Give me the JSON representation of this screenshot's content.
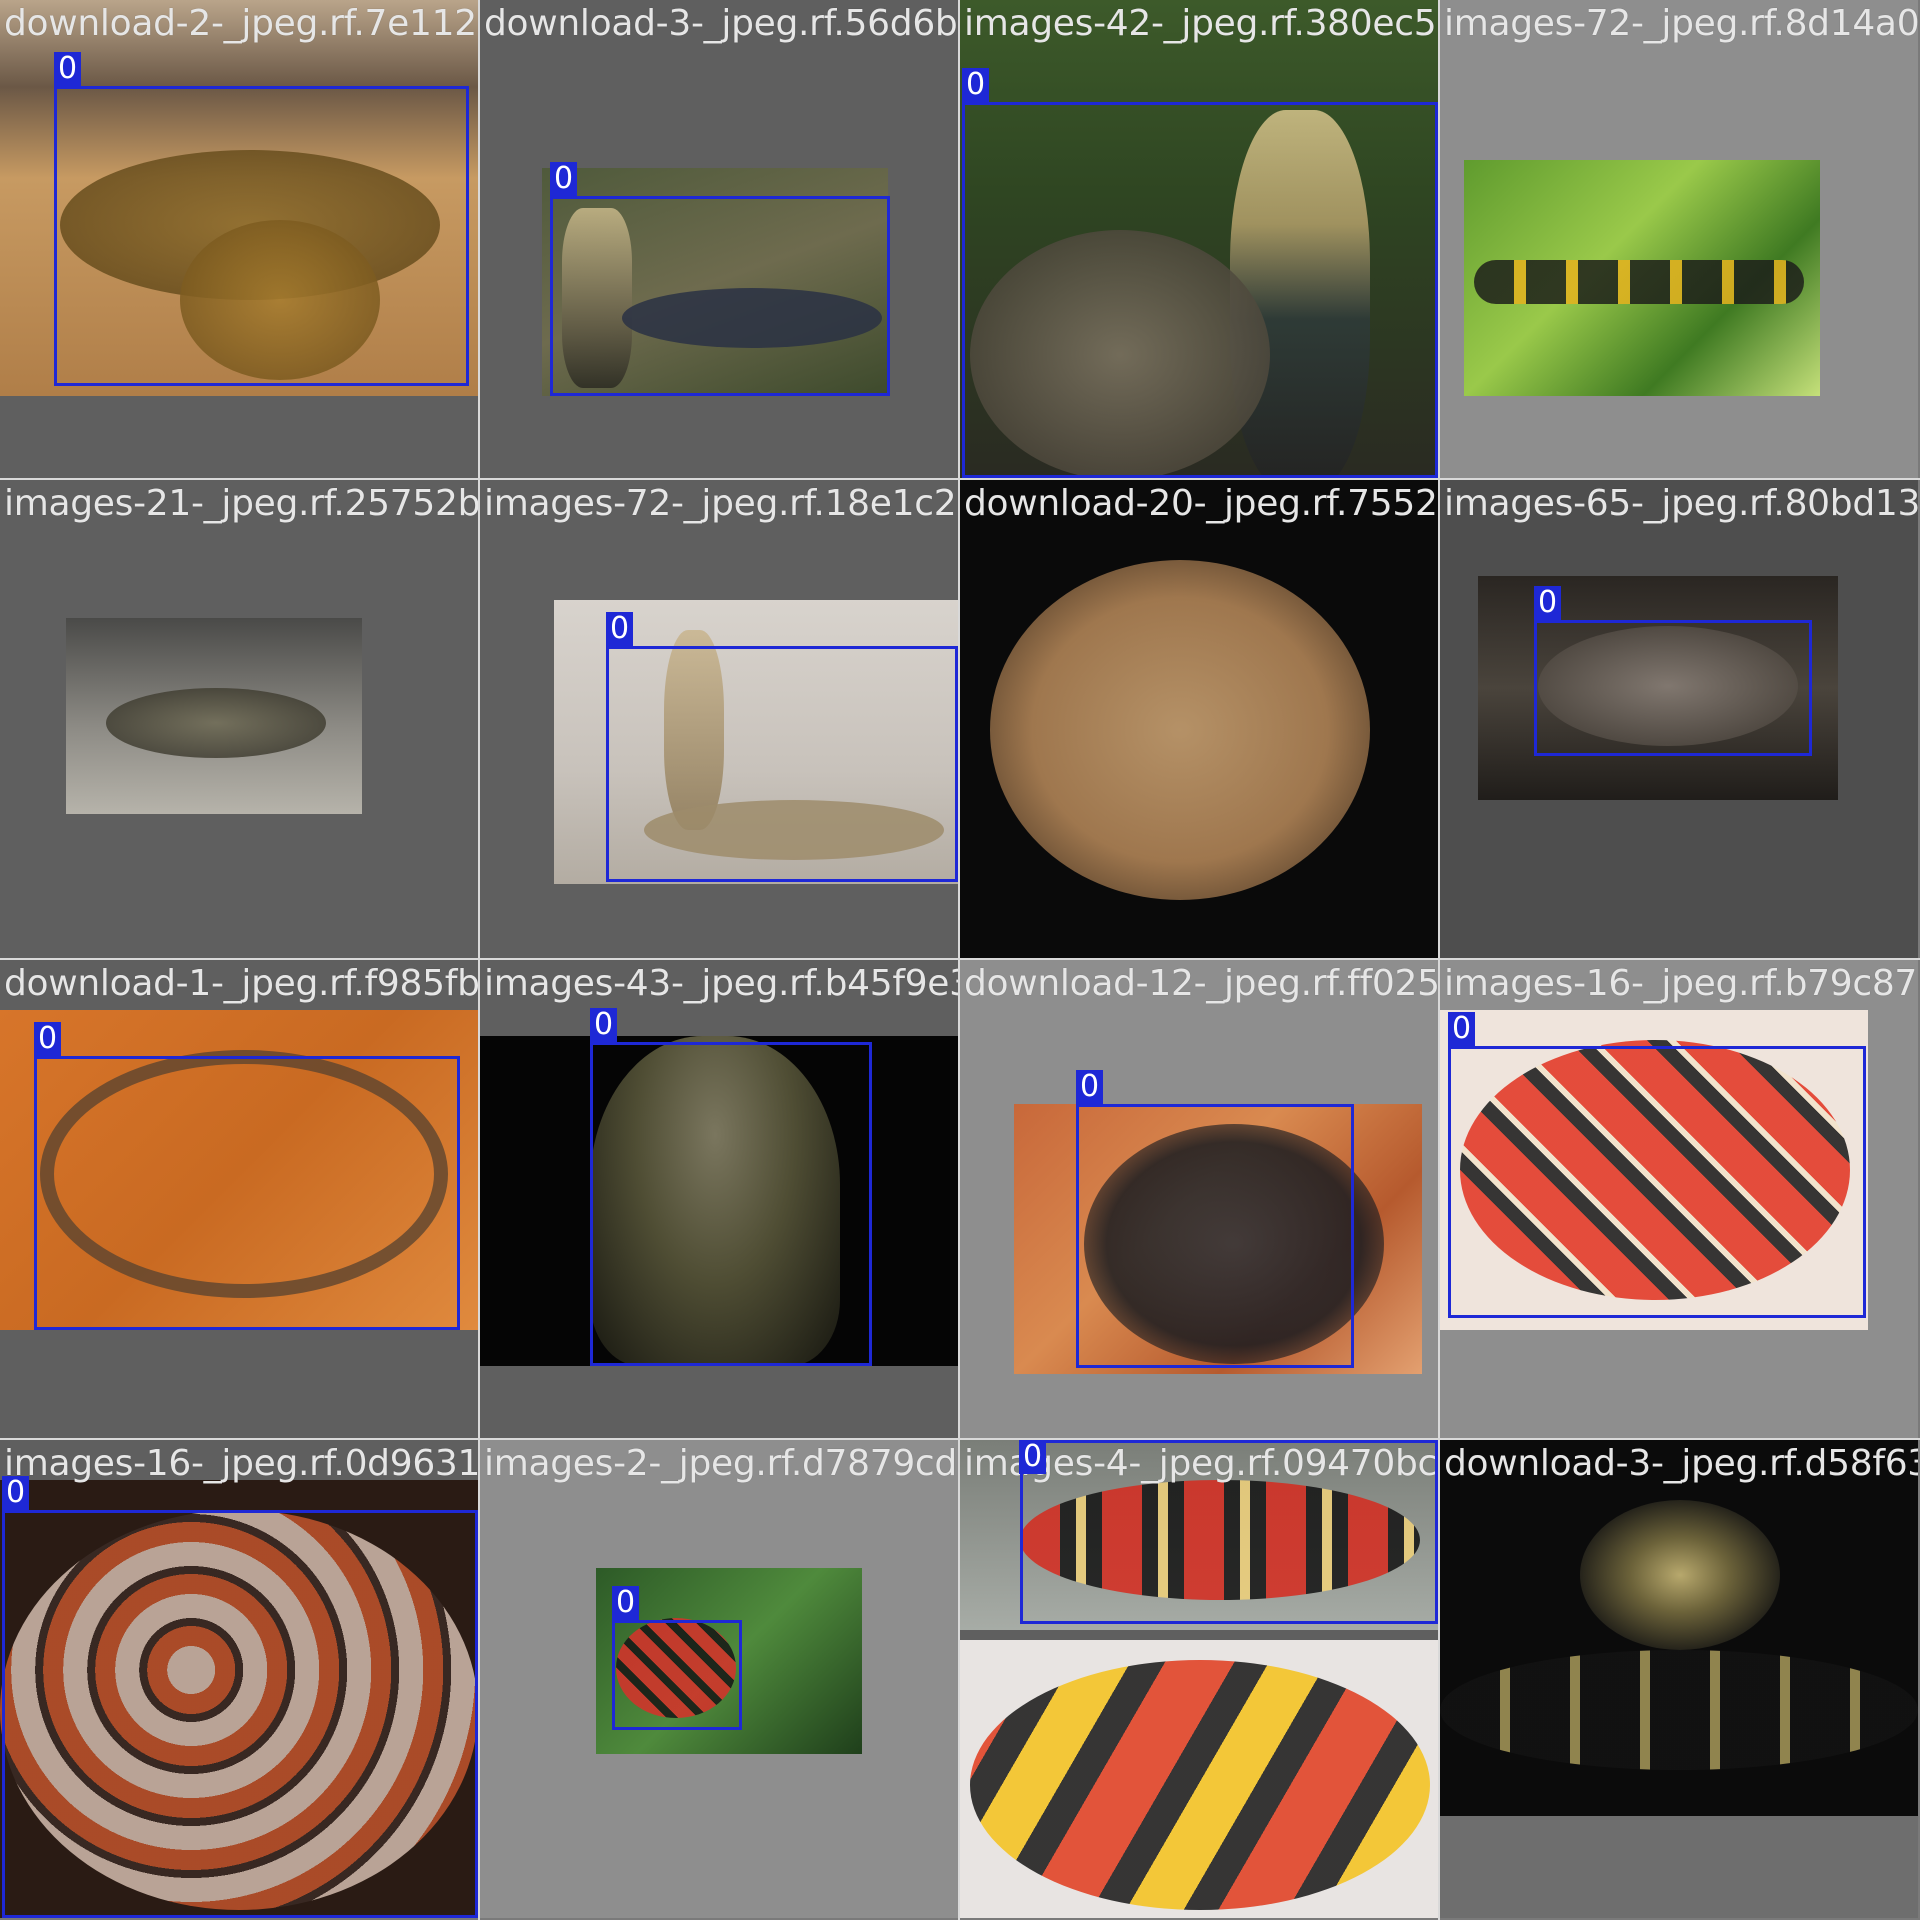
{
  "mosaic": {
    "tiles": [
      {
        "filename": "download-2-_jpeg.rf.7e112e4b6f7974fa7a92",
        "boxes": [
          {
            "label": "0"
          }
        ]
      },
      {
        "filename": "download-3-_jpeg.rf.56d6b8c3e347766b55",
        "boxes": [
          {
            "label": "0"
          }
        ]
      },
      {
        "filename": "images-42-_jpeg.rf.380ec58bd50ae1723e9e0",
        "boxes": [
          {
            "label": "0"
          }
        ]
      },
      {
        "filename": "images-72-_jpeg.rf.8d14a0c",
        "boxes": []
      },
      {
        "filename": "images-21-_jpeg.rf.25752b17f1e4b372a00ffb",
        "boxes": []
      },
      {
        "filename": "images-72-_jpeg.rf.18e1c21ebe5aa2ab86063",
        "boxes": [
          {
            "label": "0"
          }
        ]
      },
      {
        "filename": "download-20-_jpeg.rf.75527d8396906755aff9",
        "boxes": []
      },
      {
        "filename": "images-65-_jpeg.rf.80bd136",
        "boxes": [
          {
            "label": "0"
          }
        ]
      },
      {
        "filename": "download-1-_jpeg.rf.f985fb82edb1f5418ab63",
        "boxes": [
          {
            "label": "0"
          }
        ]
      },
      {
        "filename": "images-43-_jpeg.rf.b45f9e35d050319262b4",
        "boxes": [
          {
            "label": "0"
          }
        ]
      },
      {
        "filename": "download-12-_jpeg.rf.ff025d1446334d6764f",
        "boxes": [
          {
            "label": "0"
          }
        ]
      },
      {
        "filename": "images-16-_jpeg.rf.b79c87c",
        "boxes": [
          {
            "label": "0"
          }
        ]
      },
      {
        "filename": "images-16-_jpeg.rf.0d9631d5dfa8b320e5938",
        "boxes": [
          {
            "label": "0"
          }
        ]
      },
      {
        "filename": "images-2-_jpeg.rf.d7879cdd77ac4a24082b0e",
        "boxes": [
          {
            "label": "0"
          }
        ]
      },
      {
        "filename": "images-4-_jpeg.rf.09470bcbb3a5895f28507",
        "boxes": [
          {
            "label": "0"
          }
        ]
      },
      {
        "filename": "download-3-_jpeg.rf.d58f635",
        "boxes": []
      }
    ]
  },
  "colors": {
    "bbox": "#1e28d6",
    "tile_bg_dark": "#5e5e5e",
    "tile_bg_light": "#8e8e8e"
  }
}
